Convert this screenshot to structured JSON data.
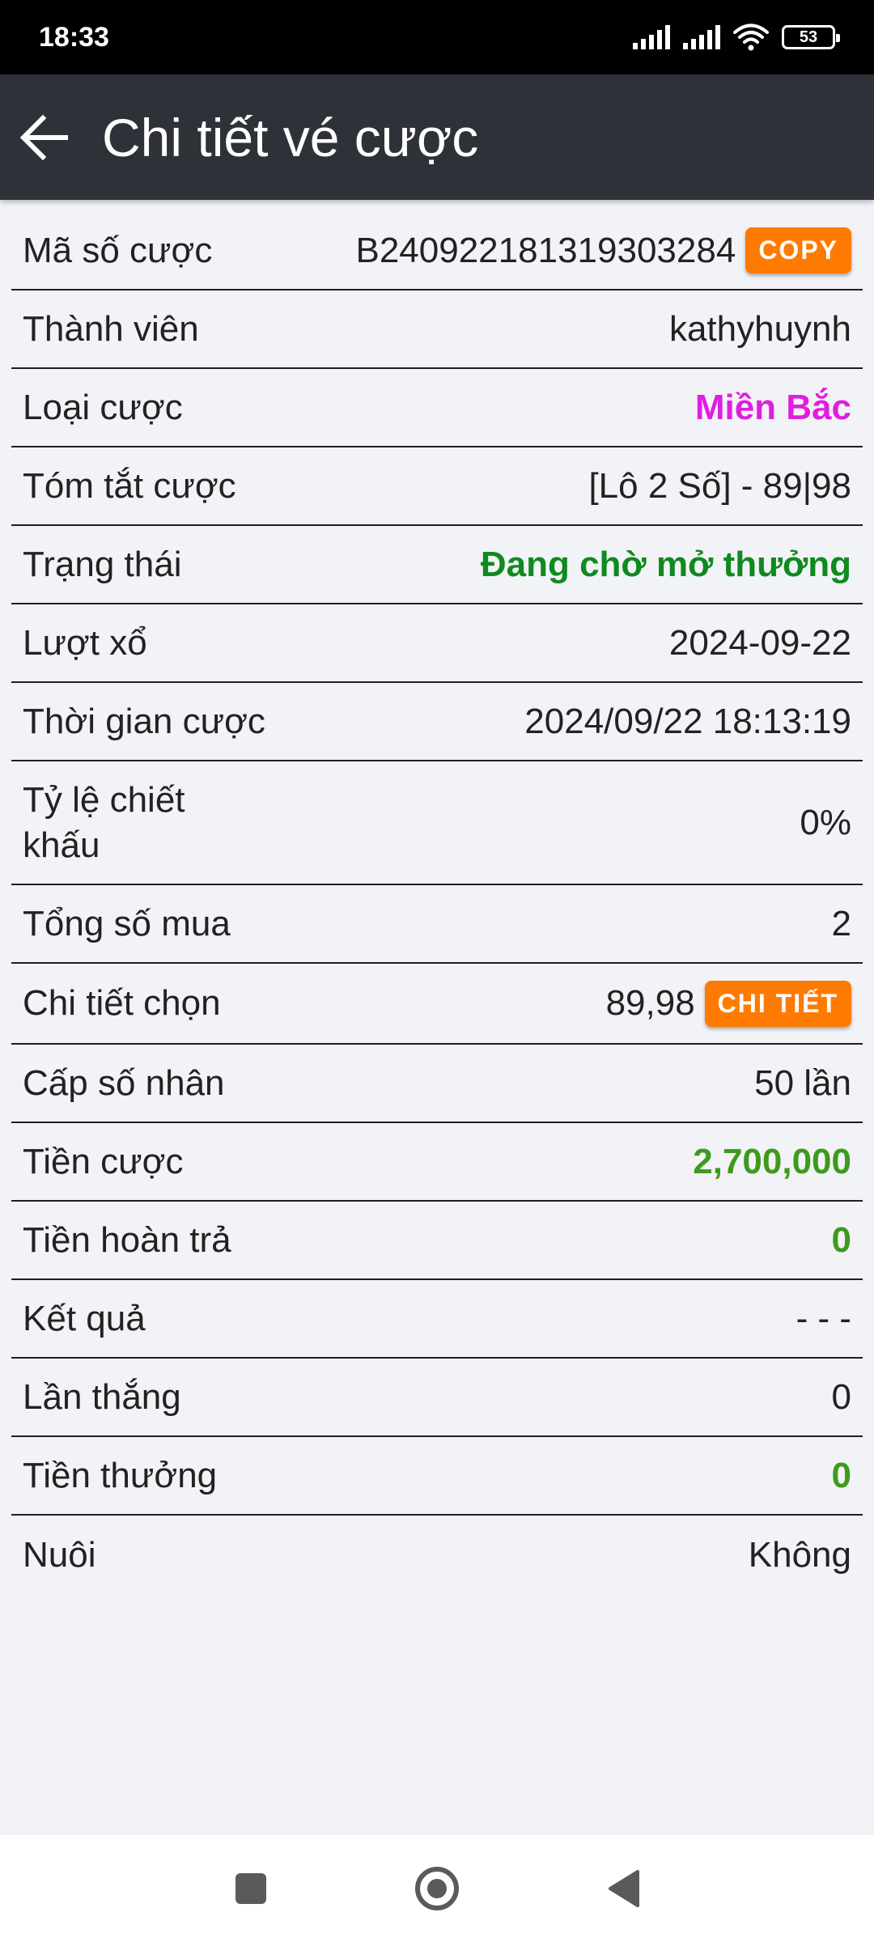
{
  "status_bar": {
    "time": "18:33",
    "battery": "53",
    "icons": [
      "signal-icon",
      "signal-icon",
      "wifi-icon",
      "battery-icon"
    ]
  },
  "app_bar": {
    "title": "Chi tiết vé cược",
    "back_icon": "arrow-left-icon"
  },
  "details": {
    "ticket_id_label": "Mã số cược",
    "ticket_id_value": "B240922181319303284",
    "copy_label": "COPY",
    "member_label": "Thành viên",
    "member_value": "kathyhuynh",
    "bet_type_label": "Loại cược",
    "bet_type_value": "Miền Bắc",
    "summary_label": "Tóm tắt cược",
    "summary_value": "[Lô 2 Số] - 89|98",
    "status_label": "Trạng thái",
    "status_value": "Đang chờ mở thưởng",
    "draw_label": "Lượt xổ",
    "draw_value": "2024-09-22",
    "bet_time_label": "Thời gian cược",
    "bet_time_value": "2024/09/22 18:13:19",
    "discount_label": "Tỷ lệ chiết khấu",
    "discount_value": "0%",
    "total_buy_label": "Tổng số mua",
    "total_buy_value": "2",
    "selection_label": "Chi tiết chọn",
    "selection_value": "89,98",
    "detail_button_label": "CHI TIẾT",
    "multiplier_label": "Cấp số nhân",
    "multiplier_value": "50 lần",
    "stake_label": "Tiền cược",
    "stake_value": "2,700,000",
    "refund_label": "Tiền hoàn trả",
    "refund_value": "0",
    "result_label": "Kết quả",
    "result_value": "- - -",
    "wins_label": "Lần thắng",
    "wins_value": "0",
    "prize_label": "Tiền thưởng",
    "prize_value": "0",
    "nurture_label": "Nuôi",
    "nurture_value": "Không"
  },
  "colors": {
    "app_bar": "#2e3238",
    "button": "#ff7a00",
    "magenta": "#e01ee0",
    "green_dark": "#0f8a1e",
    "green": "#3e9a1c"
  },
  "nav_bar": {
    "icons": [
      "recents-square-icon",
      "home-circle-icon",
      "back-triangle-icon"
    ]
  }
}
